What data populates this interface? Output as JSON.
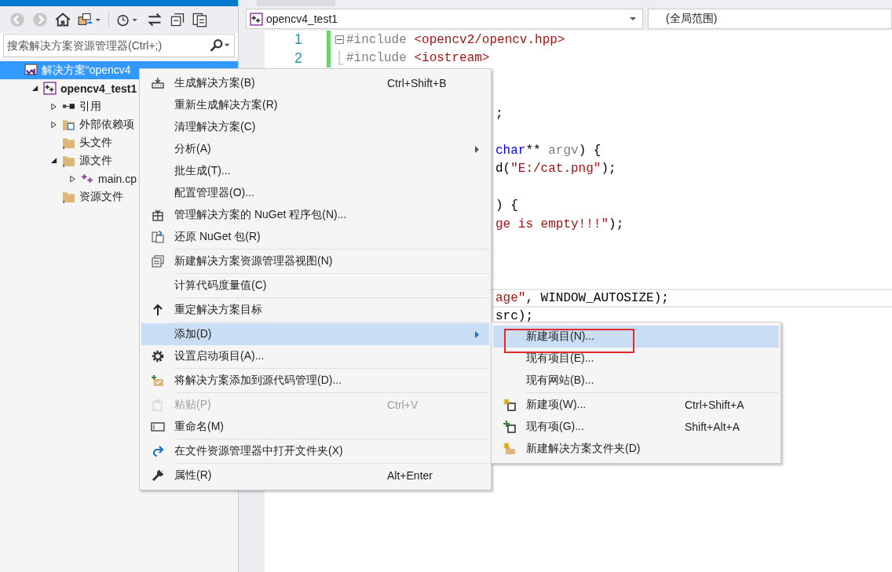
{
  "explorer": {
    "search": {
      "placeholder": "搜索解决方案资源管理器(Ctrl+;)"
    },
    "tree": [
      {
        "label": "解决方案“opencv4",
        "selected": true,
        "bold": false,
        "children": [
          {
            "label": "opencv4_test1",
            "selected": false,
            "bold": true,
            "expanded": true,
            "children": [
              {
                "label": "引用",
                "selected": false,
                "bold": false,
                "expanded": false
              },
              {
                "label": "外部依赖项",
                "selected": false,
                "bold": false,
                "expanded": false
              },
              {
                "label": "头文件",
                "selected": false,
                "bold": false
              },
              {
                "label": "源文件",
                "selected": false,
                "bold": false,
                "expanded": true,
                "children": [
                  {
                    "label": "main.cp",
                    "selected": false,
                    "bold": false,
                    "expanded": false
                  }
                ]
              },
              {
                "label": "资源文件",
                "selected": false,
                "bold": false
              }
            ]
          }
        ]
      }
    ]
  },
  "editor": {
    "project_dropdown": "opencv4_test1",
    "scope_dropdown": "(全局范围)",
    "lines": [
      {
        "number": "1",
        "current": false,
        "tokens": [
          {
            "kind": "pre",
            "text": "#include "
          },
          {
            "kind": "str",
            "text": "<opencv2/opencv.hpp>"
          }
        ]
      },
      {
        "number": "2",
        "current": false,
        "tokens": [
          {
            "kind": "pre",
            "text": "#include "
          },
          {
            "kind": "str",
            "text": "<iostream>"
          }
        ]
      },
      {
        "current": false
      },
      {
        "current": false
      },
      {
        "current": false,
        "tokens": [
          {
            "kind": "plain",
            "text": ";"
          }
        ]
      },
      {
        "current": false
      },
      {
        "current": false,
        "tokens": [
          {
            "kind": "kw",
            "text": "char"
          },
          {
            "kind": "plain",
            "text": "** "
          },
          {
            "kind": "param",
            "text": "argv"
          },
          {
            "kind": "plain",
            "text": ") {"
          }
        ]
      },
      {
        "current": false,
        "tokens": [
          {
            "kind": "plain",
            "text": "d("
          },
          {
            "kind": "str",
            "text": "\"E:/cat.png\""
          },
          {
            "kind": "plain",
            "text": ");"
          }
        ]
      },
      {
        "current": false
      },
      {
        "current": false,
        "tokens": [
          {
            "kind": "plain",
            "text": ") {"
          }
        ]
      },
      {
        "current": false,
        "tokens": [
          {
            "kind": "str",
            "text": "ge is empty!!!\""
          },
          {
            "kind": "plain",
            "text": ");"
          }
        ]
      },
      {
        "current": false
      },
      {
        "current": false
      },
      {
        "current": false
      },
      {
        "current": true,
        "tokens": [
          {
            "kind": "str",
            "text": "age\""
          },
          {
            "kind": "plain",
            "text": ", WINDOW_AUTOSIZE);"
          }
        ]
      },
      {
        "current": false,
        "tokens": [
          {
            "kind": "plain",
            "text": "src);"
          }
        ]
      }
    ]
  },
  "context_menu": {
    "groups": [
      [
        {
          "label": "生成解决方案(B)",
          "shortcut": "Ctrl+Shift+B",
          "disabled": false,
          "selected": false,
          "submenu": false
        },
        {
          "label": "重新生成解决方案(R)",
          "disabled": false,
          "selected": false,
          "submenu": false
        },
        {
          "label": "清理解决方案(C)",
          "disabled": false,
          "selected": false,
          "submenu": false
        },
        {
          "label": "分析(A)",
          "disabled": false,
          "selected": false,
          "submenu": true
        },
        {
          "label": "批生成(T)...",
          "disabled": false,
          "selected": false,
          "submenu": false
        },
        {
          "label": "配置管理器(O)...",
          "disabled": false,
          "selected": false,
          "submenu": false
        },
        {
          "label": "管理解决方案的 NuGet 程序包(N)...",
          "disabled": false,
          "selected": false,
          "submenu": false
        },
        {
          "label": "还原 NuGet 包(R)",
          "disabled": false,
          "selected": false,
          "submenu": false
        }
      ],
      [
        {
          "label": "新建解决方案资源管理器视图(N)",
          "disabled": false,
          "selected": false,
          "submenu": false
        }
      ],
      [
        {
          "label": "计算代码度量值(C)",
          "disabled": false,
          "selected": false,
          "submenu": false
        }
      ],
      [
        {
          "label": "重定解决方案目标",
          "disabled": false,
          "selected": false,
          "submenu": false
        }
      ],
      [
        {
          "label": "添加(D)",
          "disabled": false,
          "selected": true,
          "submenu": true
        },
        {
          "label": "设置启动项目(A)...",
          "disabled": false,
          "selected": false,
          "submenu": false
        }
      ],
      [
        {
          "label": "将解决方案添加到源代码管理(D)...",
          "disabled": false,
          "selected": false,
          "submenu": false
        }
      ],
      [
        {
          "label": "粘贴(P)",
          "shortcut": "Ctrl+V",
          "disabled": true,
          "selected": false,
          "submenu": false
        },
        {
          "label": "重命名(M)",
          "disabled": false,
          "selected": false,
          "submenu": false
        }
      ],
      [
        {
          "label": "在文件资源管理器中打开文件夹(X)",
          "disabled": false,
          "selected": false,
          "submenu": false
        }
      ],
      [
        {
          "label": "属性(R)",
          "shortcut": "Alt+Enter",
          "disabled": false,
          "selected": false,
          "submenu": false
        }
      ]
    ]
  },
  "submenu": {
    "groups": [
      [
        {
          "label": "新建项目(N)...",
          "selected": true,
          "outlined": true
        },
        {
          "label": "现有项目(E)...",
          "selected": false,
          "outlined": false
        },
        {
          "label": "现有网站(B)...",
          "selected": false,
          "outlined": false
        }
      ],
      [
        {
          "label": "新建项(W)...",
          "shortcut": "Ctrl+Shift+A",
          "selected": false,
          "outlined": false
        },
        {
          "label": "现有项(G)...",
          "shortcut": "Shift+Alt+A",
          "selected": false,
          "outlined": false
        },
        {
          "label": "新建解决方案文件夹(D)",
          "selected": false,
          "outlined": false
        }
      ]
    ]
  }
}
